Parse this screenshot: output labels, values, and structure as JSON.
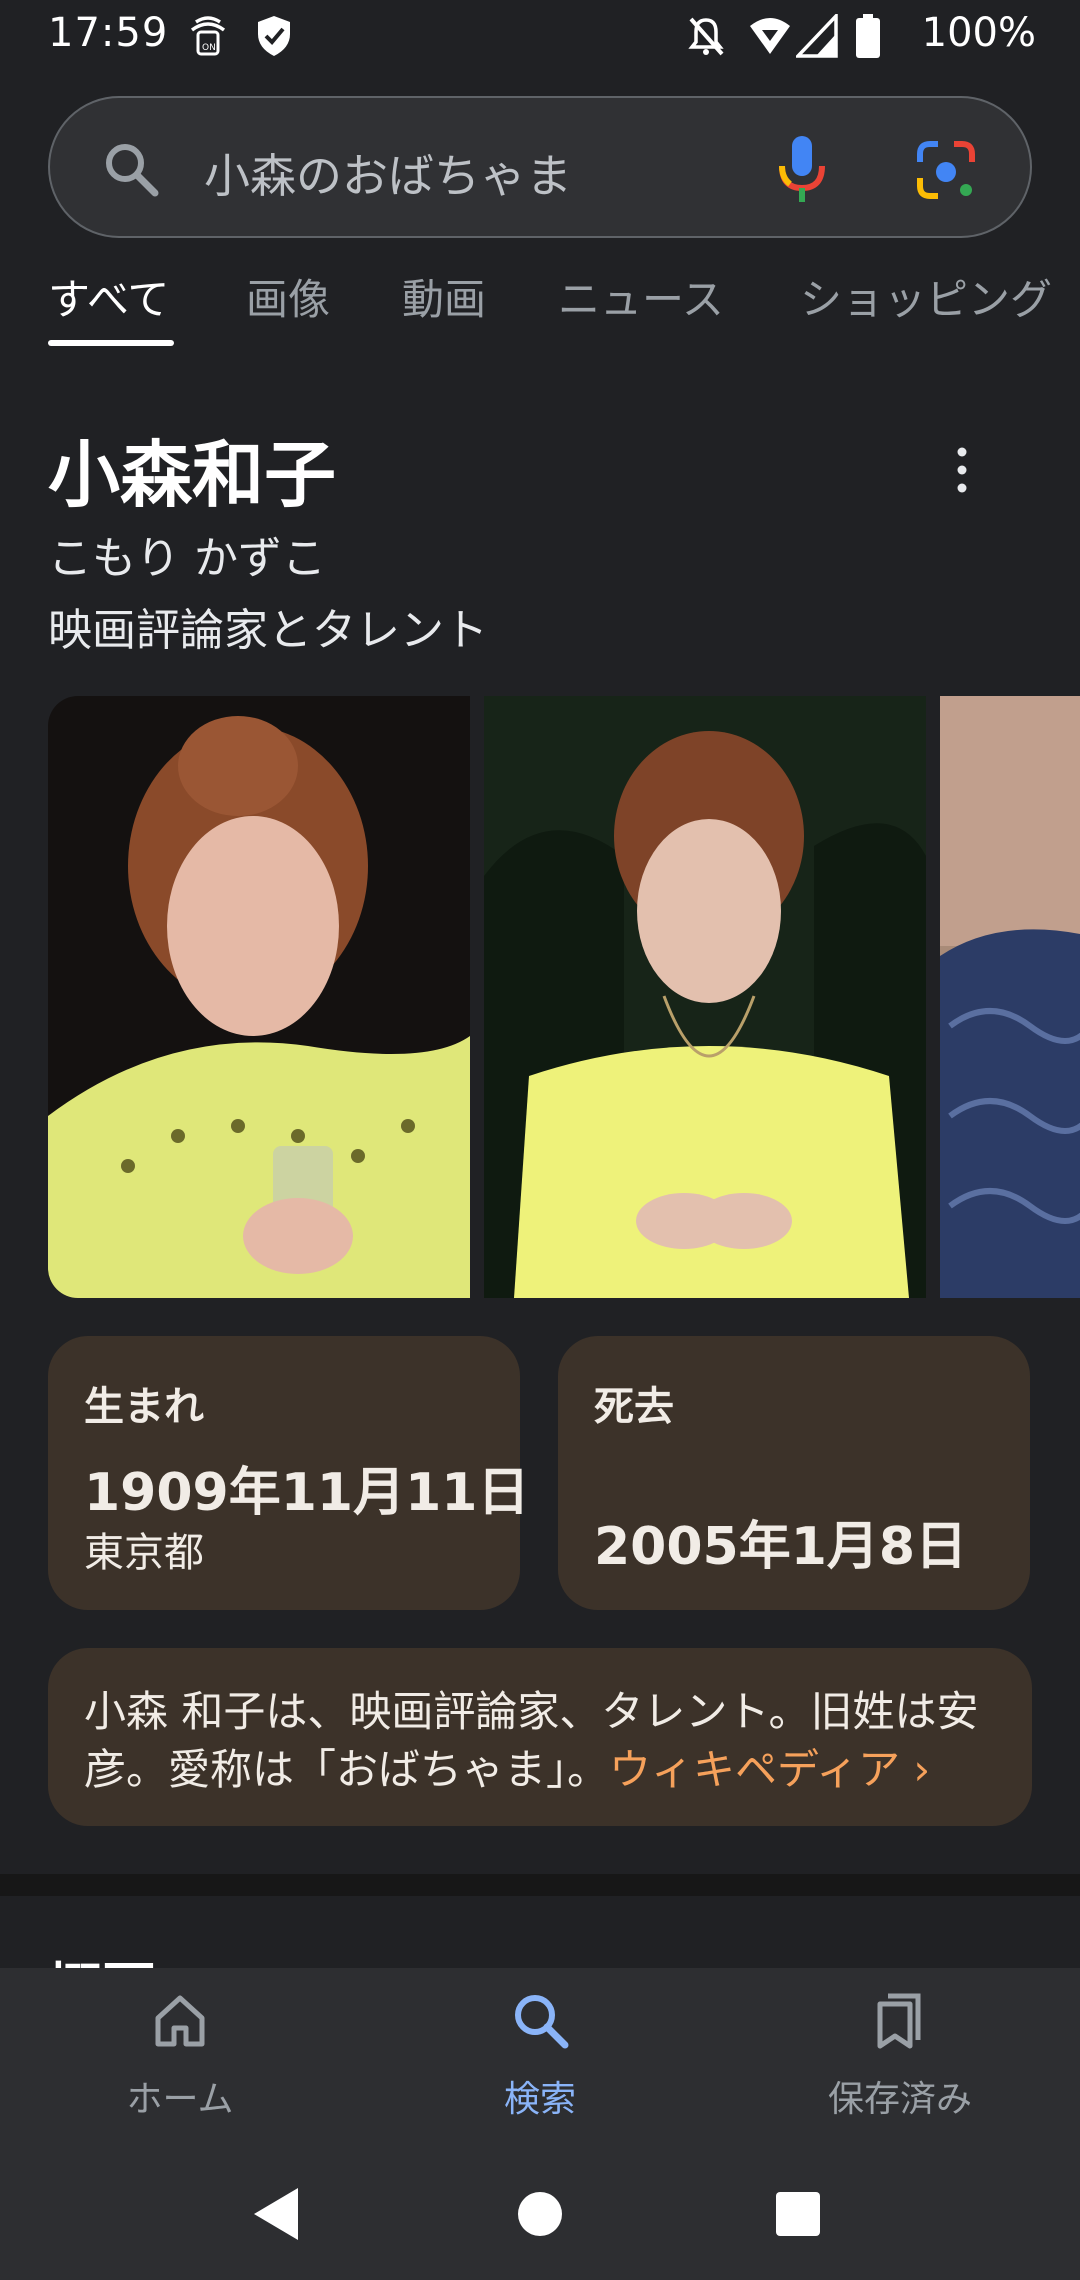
{
  "status_bar": {
    "time": "17:59",
    "battery": "100%",
    "icons": [
      "nfc-on-icon",
      "shield-check-icon",
      "bell-off-icon",
      "wifi-icon",
      "signal-icon",
      "battery-icon"
    ]
  },
  "search": {
    "query": "小森のおばちゃま",
    "icons": [
      "search-icon",
      "mic-icon",
      "lens-icon"
    ]
  },
  "tabs": [
    {
      "label": "すべて",
      "active": true
    },
    {
      "label": "画像",
      "active": false
    },
    {
      "label": "動画",
      "active": false
    },
    {
      "label": "ニュース",
      "active": false
    },
    {
      "label": "ショッピング",
      "active": false
    }
  ],
  "knowledge_panel": {
    "title": "小森和子",
    "reading": "こもり かずこ",
    "description": "映画評論家とタレント",
    "facts": [
      {
        "label": "生まれ",
        "value": "1909年11月11日",
        "sub": "東京都"
      },
      {
        "label": "死去",
        "value": "2005年1月8日"
      }
    ],
    "summary_line1": "小森 和子は、映画評論家、タレント。旧姓は安",
    "summary_line2": "彦。愛称は「おばちゃま」。",
    "wiki_link": "ウィキペディア ›",
    "next_section_heading": "概要"
  },
  "bottom_nav": [
    {
      "label": "ホーム",
      "icon": "home-icon",
      "active": false
    },
    {
      "label": "検索",
      "icon": "search-icon",
      "active": true
    },
    {
      "label": "保存済み",
      "icon": "bookmarks-icon",
      "active": false
    }
  ],
  "colors": {
    "background": "#202124",
    "card": "#3c3229",
    "link": "#f6a15b",
    "active_nav": "#8ab4f8"
  }
}
